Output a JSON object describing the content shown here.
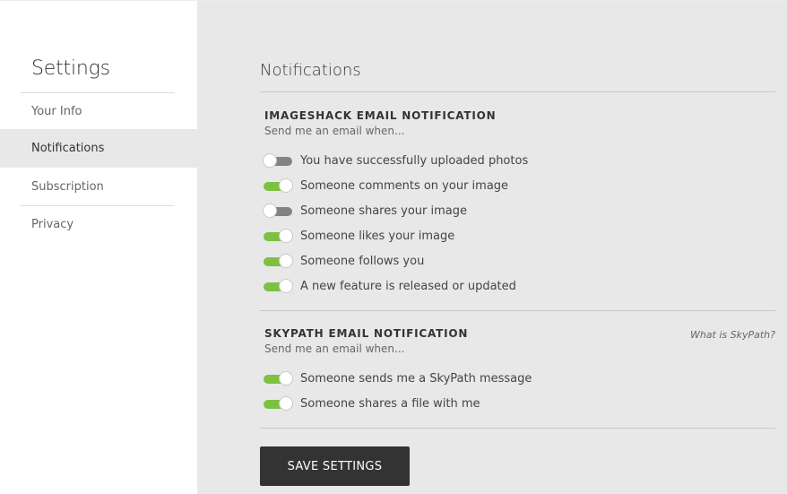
{
  "sidebar": {
    "title": "Settings",
    "items": [
      {
        "label": "Your Info",
        "active": false
      },
      {
        "label": "Notifications",
        "active": true
      },
      {
        "label": "Subscription",
        "active": false
      },
      {
        "label": "Privacy",
        "active": false
      }
    ]
  },
  "main": {
    "title": "Notifications",
    "sections": [
      {
        "title": "IMAGESHACK EMAIL NOTIFICATION",
        "subtitle": "Send me an email when...",
        "options": [
          {
            "label": "You have successfully uploaded photos",
            "enabled": false
          },
          {
            "label": "Someone comments on your image",
            "enabled": true
          },
          {
            "label": "Someone shares your image",
            "enabled": false
          },
          {
            "label": "Someone likes your image",
            "enabled": true
          },
          {
            "label": "Someone follows you",
            "enabled": true
          },
          {
            "label": "A new feature is released or updated",
            "enabled": true
          }
        ]
      },
      {
        "title": "SKYPATH EMAIL NOTIFICATION",
        "subtitle": "Send me an email when...",
        "link": "What is SkyPath?",
        "options": [
          {
            "label": "Someone sends me a SkyPath message",
            "enabled": true
          },
          {
            "label": "Someone shares a file with me",
            "enabled": true
          }
        ]
      }
    ],
    "save_label": "SAVE SETTINGS"
  },
  "colors": {
    "toggle_on": "#7dc142",
    "toggle_off": "#838383",
    "button_bg": "#333333",
    "page_bg": "#e8e8e8",
    "sidebar_bg": "#ffffff"
  }
}
